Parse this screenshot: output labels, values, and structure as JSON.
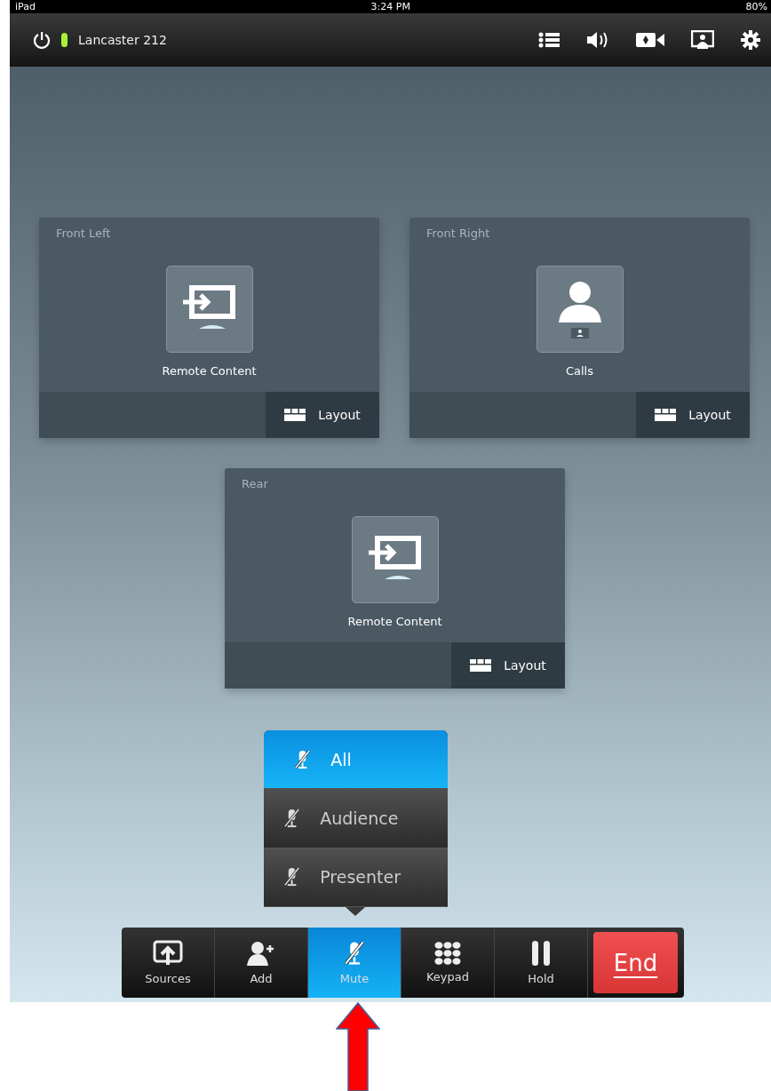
{
  "status_bar": {
    "device": "iPad",
    "time": "3:24 PM",
    "battery": "80%"
  },
  "top_bar": {
    "room": "Lancaster 212"
  },
  "displays": [
    {
      "title": "Front Left",
      "kind": "remote-content",
      "source": "Remote Content",
      "button": "Layout"
    },
    {
      "title": "Front Right",
      "kind": "calls",
      "source": "Calls",
      "button": "Layout"
    },
    {
      "title": "Rear",
      "kind": "remote-content",
      "source": "Remote Content",
      "button": "Layout"
    }
  ],
  "mute_menu": [
    {
      "label": "All",
      "selected": true
    },
    {
      "label": "Audience",
      "selected": false
    },
    {
      "label": "Presenter",
      "selected": false
    }
  ],
  "toolbar": [
    {
      "kind": "sources",
      "label": "Sources",
      "selected": false
    },
    {
      "kind": "add",
      "label": "Add",
      "selected": false
    },
    {
      "kind": "mute",
      "label": "Mute",
      "selected": true
    },
    {
      "kind": "keypad",
      "label": "Keypad",
      "selected": false
    },
    {
      "kind": "hold",
      "label": "Hold",
      "selected": false
    },
    {
      "kind": "end",
      "label": "End",
      "selected": false
    }
  ]
}
